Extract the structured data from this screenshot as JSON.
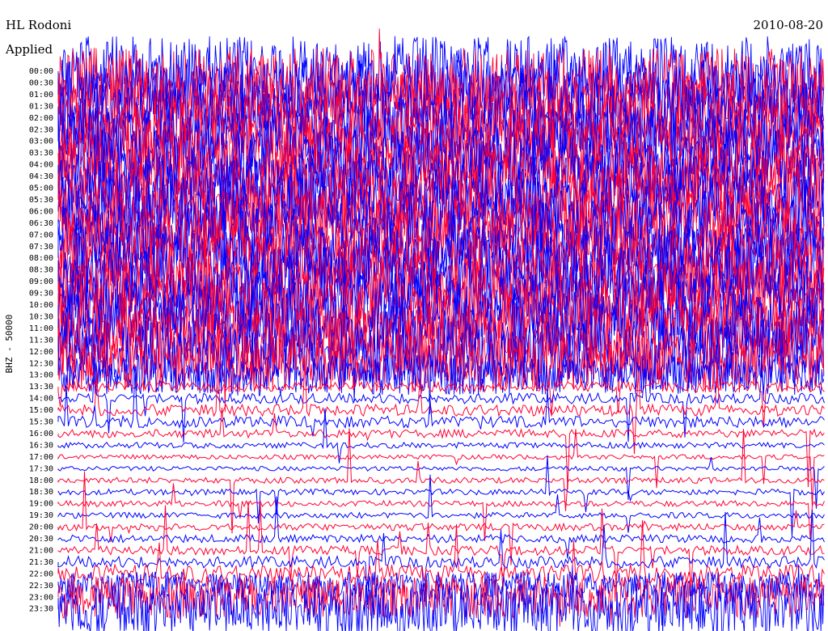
{
  "header": {
    "station": "HL Rodoni",
    "applied": "Applied",
    "date": "2010-08-20"
  },
  "chart_data": {
    "type": "line",
    "channel_label": "BHZ - 50000",
    "row_labels": [
      "00:00",
      "00:30",
      "01:00",
      "01:30",
      "02:00",
      "02:30",
      "03:00",
      "03:30",
      "04:00",
      "04:30",
      "05:00",
      "05:30",
      "06:00",
      "06:30",
      "07:00",
      "07:30",
      "08:00",
      "08:30",
      "09:00",
      "09:30",
      "10:00",
      "10:30",
      "11:00",
      "11:30",
      "12:00",
      "12:30",
      "13:00",
      "13:30",
      "14:00",
      "15:00",
      "15:30",
      "16:00",
      "16:30",
      "17:00",
      "17:30",
      "18:00",
      "18:30",
      "19:00",
      "19:30",
      "20:00",
      "20:30",
      "21:00",
      "21:30",
      "22:00",
      "22:30",
      "23:00",
      "23:30"
    ],
    "series_colors": [
      "#0000ff",
      "#ff0033"
    ],
    "row_activity": [
      6,
      6,
      6,
      6,
      6,
      6,
      6,
      6,
      6,
      6,
      6,
      6,
      6,
      6,
      6,
      6,
      6,
      6,
      6,
      6,
      6,
      6,
      6,
      6,
      5.5,
      5,
      3.5,
      0.9,
      0.9,
      1.0,
      1.0,
      0.7,
      0.5,
      0.4,
      0.4,
      0.5,
      0.5,
      0.5,
      0.5,
      0.6,
      0.7,
      0.8,
      1.0,
      1.6,
      2.4,
      3.6,
      4.5
    ]
  }
}
